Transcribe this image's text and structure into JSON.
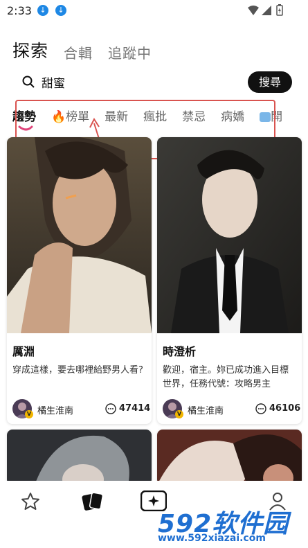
{
  "status": {
    "time": "2:33"
  },
  "top_tabs": [
    {
      "label": "探索",
      "active": true
    },
    {
      "label": "合輯",
      "active": false
    },
    {
      "label": "追蹤中",
      "active": false
    }
  ],
  "search": {
    "value": "甜蜜",
    "button_label": "搜尋"
  },
  "categories": [
    {
      "label": "趨勢",
      "active": true
    },
    {
      "label": "榜單",
      "icon": "fire-icon"
    },
    {
      "label": "最新"
    },
    {
      "label": "瘋批"
    },
    {
      "label": "禁忌"
    },
    {
      "label": "病嬌"
    },
    {
      "label": "開",
      "icon": "emoji-icon"
    }
  ],
  "cards": [
    {
      "name": "厲淵",
      "description": "穿成這樣，要去哪裡給野男人看?",
      "author": "橘生淮南",
      "comments": "47414"
    },
    {
      "name": "時澄析",
      "description": "歡迎，宿主。妳已成功進入目標世界，任務代號：攻略男主",
      "author": "橘生淮南",
      "comments": "46106"
    }
  ],
  "watermark": {
    "brand": "592软件园",
    "url": "www.592xiazai.com"
  },
  "colors": {
    "accent_pink": "#e0457b",
    "annotation_red": "#d9534f",
    "search_button_bg": "#111111"
  }
}
